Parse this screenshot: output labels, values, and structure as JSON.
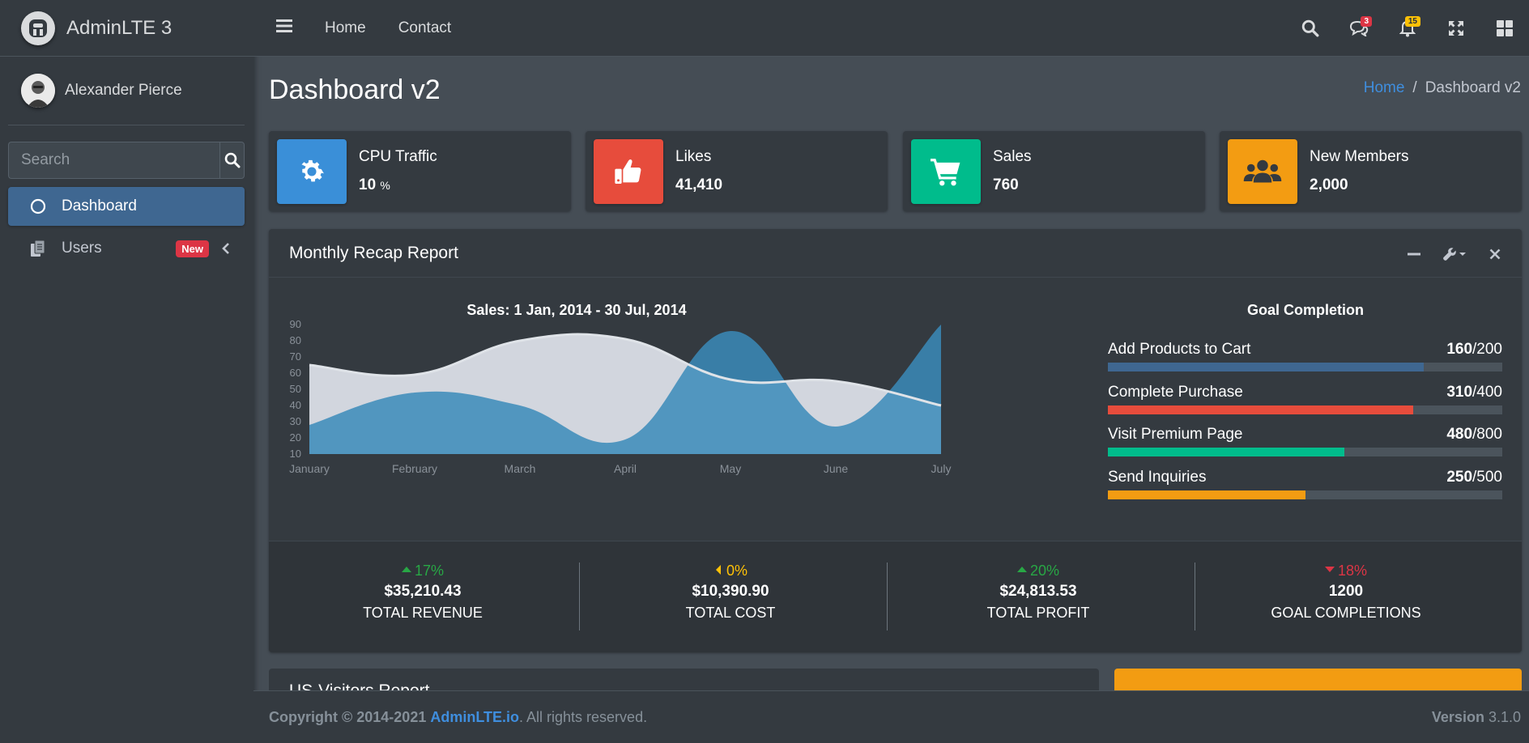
{
  "brand": {
    "name": "AdminLTE 3"
  },
  "user": {
    "name": "Alexander Pierce"
  },
  "sidebar": {
    "search_placeholder": "Search",
    "items": [
      {
        "label": "Dashboard",
        "icon": "circle-icon",
        "active": true
      },
      {
        "label": "Users",
        "icon": "copy-icon",
        "badge": "New"
      }
    ]
  },
  "topnav": {
    "links": [
      "Home",
      "Contact"
    ],
    "messages_badge": "3",
    "notifications_badge": "15"
  },
  "header": {
    "title": "Dashboard v2",
    "breadcrumb": [
      "Home",
      "/",
      "Dashboard v2"
    ]
  },
  "info_boxes": [
    {
      "label": "CPU Traffic",
      "value": "10",
      "unit": "%",
      "icon": "gear-icon",
      "color": "#3a8fd8"
    },
    {
      "label": "Likes",
      "value": "41,410",
      "icon": "thumbs-up-icon",
      "color": "#e74c3c"
    },
    {
      "label": "Sales",
      "value": "760",
      "icon": "cart-icon",
      "color": "#00bc8c"
    },
    {
      "label": "New Members",
      "value": "2,000",
      "icon": "users-icon",
      "color": "#f39c12"
    }
  ],
  "recap": {
    "title": "Monthly Recap Report",
    "chart_title": "Sales: 1 Jan, 2014 - 30 Jul, 2014",
    "goal_title": "Goal Completion",
    "goals": [
      {
        "label": "Add Products to Cart",
        "done": "160",
        "total": "/200",
        "fraction": 0.8,
        "color": "#3f6791"
      },
      {
        "label": "Complete Purchase",
        "done": "310",
        "total": "/400",
        "fraction": 0.775,
        "color": "#e74c3c"
      },
      {
        "label": "Visit Premium Page",
        "done": "480",
        "total": "/800",
        "fraction": 0.6,
        "color": "#00bc8c"
      },
      {
        "label": "Send Inquiries",
        "done": "250",
        "total": "/500",
        "fraction": 0.5,
        "color": "#f39c12"
      }
    ],
    "stats": [
      {
        "pct": "17%",
        "direction": "up",
        "color": "#28a745",
        "value": "$35,210.43",
        "label": "TOTAL REVENUE"
      },
      {
        "pct": "0%",
        "direction": "left",
        "color": "#ffc107",
        "value": "$10,390.90",
        "label": "TOTAL COST"
      },
      {
        "pct": "20%",
        "direction": "up",
        "color": "#28a745",
        "value": "$24,813.53",
        "label": "TOTAL PROFIT"
      },
      {
        "pct": "18%",
        "direction": "down",
        "color": "#dc3545",
        "value": "1200",
        "label": "GOAL COMPLETIONS"
      }
    ]
  },
  "chart_data": {
    "type": "area",
    "title": "Sales: 1 Jan, 2014 - 30 Jul, 2014",
    "categories": [
      "January",
      "February",
      "March",
      "April",
      "May",
      "June",
      "July"
    ],
    "ylim": [
      10,
      90
    ],
    "yticks": [
      10,
      20,
      30,
      40,
      50,
      60,
      70,
      80,
      90
    ],
    "series": [
      {
        "values": [
          28,
          48,
          40,
          19,
          86,
          27,
          90
        ],
        "color": "#3b8bba"
      },
      {
        "values": [
          65,
          59,
          80,
          81,
          56,
          55,
          40
        ],
        "color": "#d2d6de"
      }
    ],
    "grid": false
  },
  "lower": {
    "visitors_title": "US-Visitors Report"
  },
  "footer": {
    "copyright": "Copyright © 2014-2021",
    "link": "AdminLTE.io",
    "rights": ". All rights reserved.",
    "version_label": "Version",
    "version": "3.1.0"
  }
}
